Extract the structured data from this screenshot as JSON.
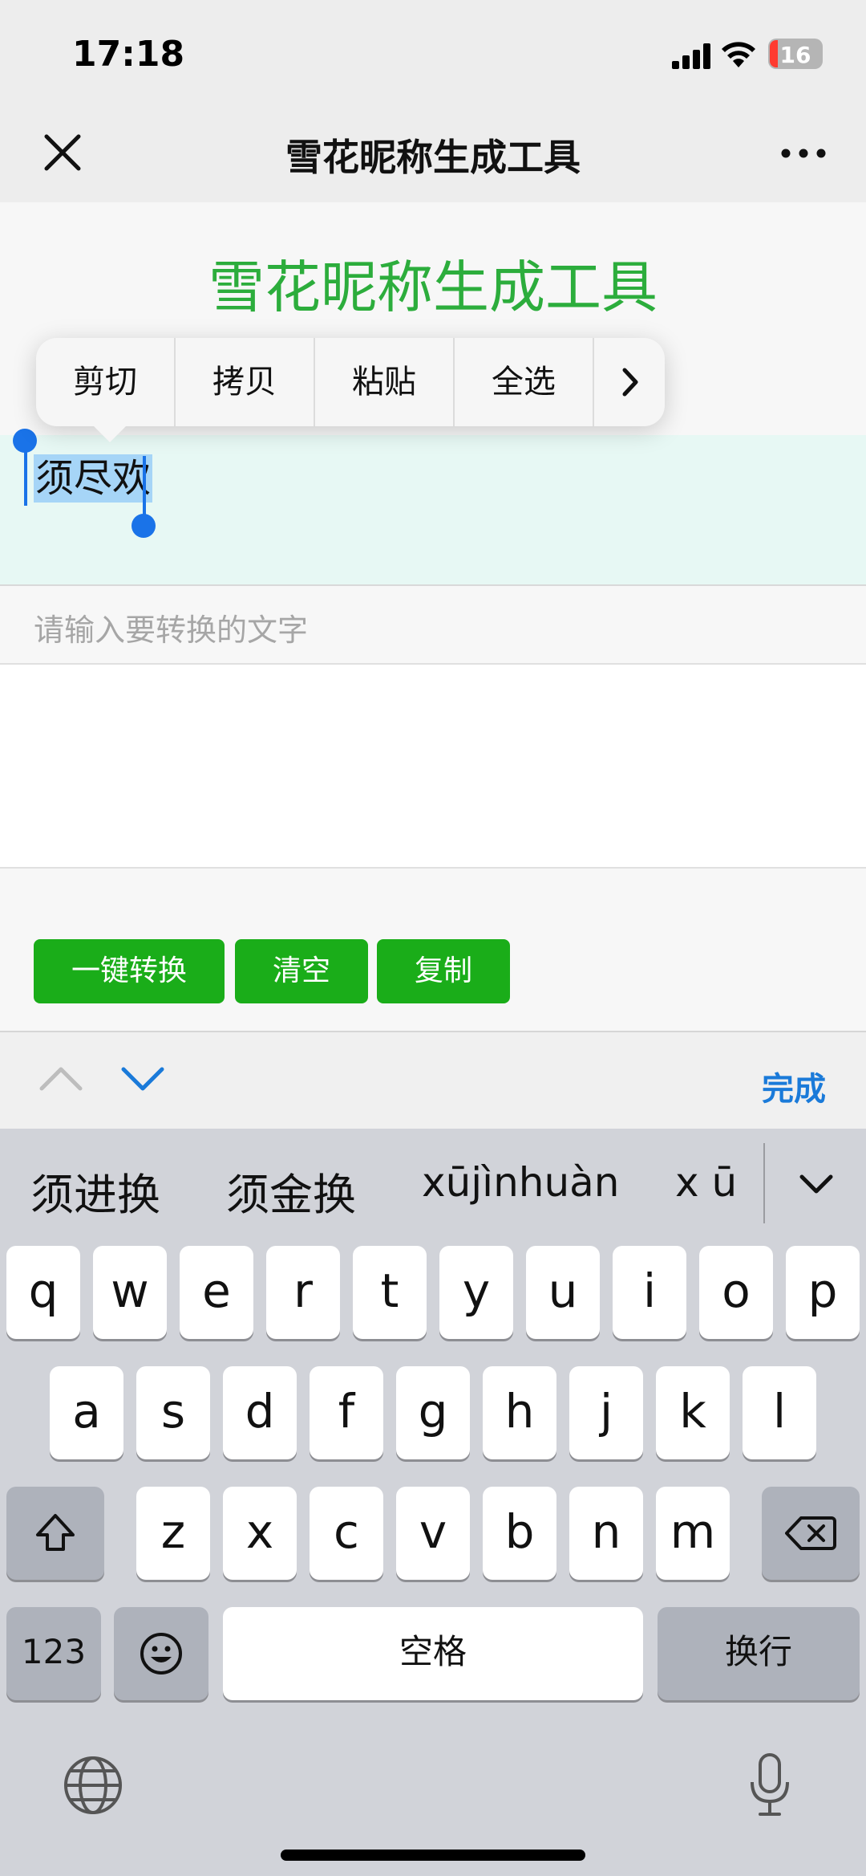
{
  "status": {
    "time": "17:18",
    "battery": "16"
  },
  "nav": {
    "title": "雪花昵称生成工具"
  },
  "page": {
    "heading": "雪花昵称生成工具",
    "result_text": "须尽欢",
    "input_placeholder": "请输入要转换的文字",
    "buttons": {
      "convert": "一键转换",
      "clear": "清空",
      "copy": "复制"
    }
  },
  "edit_menu": {
    "items": [
      "剪切",
      "拷贝",
      "粘贴",
      "全选"
    ]
  },
  "accessory": {
    "done": "完成"
  },
  "keyboard": {
    "candidates": [
      "须进换",
      "须金换",
      "xūjìnhuàn",
      "x ū"
    ],
    "row1": [
      "q",
      "w",
      "e",
      "r",
      "t",
      "y",
      "u",
      "i",
      "o",
      "p"
    ],
    "row2": [
      "a",
      "s",
      "d",
      "f",
      "g",
      "h",
      "j",
      "k",
      "l"
    ],
    "row3": [
      "z",
      "x",
      "c",
      "v",
      "b",
      "n",
      "m"
    ],
    "numbers_key": "123",
    "space_key": "空格",
    "return_key": "换行"
  }
}
